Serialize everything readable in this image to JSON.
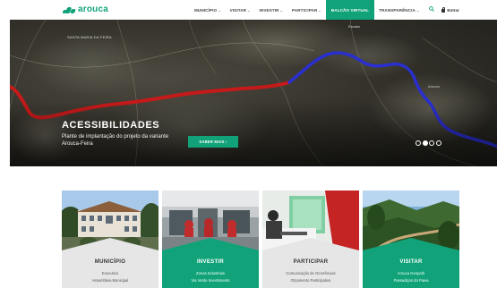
{
  "brand": {
    "name": "arouca",
    "color": "#11a27a"
  },
  "nav": {
    "items": [
      {
        "label": "MUNICÍPIO",
        "has_dropdown": true,
        "active": false
      },
      {
        "label": "VISITAR",
        "has_dropdown": true,
        "active": false
      },
      {
        "label": "INVESTIR",
        "has_dropdown": true,
        "active": false
      },
      {
        "label": "PARTICIPAR",
        "has_dropdown": true,
        "active": false
      },
      {
        "label": "BALCÃO VIRTUAL",
        "has_dropdown": false,
        "active": true
      },
      {
        "label": "TRANSPARÊNCIA",
        "has_dropdown": true,
        "active": false
      }
    ],
    "search_icon": "search-icon",
    "login_label": "Entrar",
    "login_icon": "lock-icon"
  },
  "hero": {
    "map_labels": {
      "location": "SANTA MARIA DA FEIRA",
      "upper": "Escariz",
      "right": "Arouca"
    },
    "title": "ACESSIBILIDADES",
    "subtitle": "Plante de implantação do projeto da variante Arouca-Feira",
    "button_label": "SABER MAIS",
    "button_icon": "chevron-right-icon",
    "slides": 4,
    "active_slide": 2,
    "route_colors": {
      "existing": "#c61a1a",
      "planned": "#2a2fd0"
    }
  },
  "cards": [
    {
      "title": "MUNICÍPIO",
      "lines": [
        "Executivo",
        "Assembleia Municipal"
      ],
      "style": "grey"
    },
    {
      "title": "INVESTIR",
      "lines": [
        "Zonas Industriais",
        "Via Verde Investimento"
      ],
      "style": "green"
    },
    {
      "title": "PARTICIPAR",
      "lines": [
        "Comunicação de Ocorrências",
        "Orçamento Participativo"
      ],
      "style": "grey"
    },
    {
      "title": "VISITAR",
      "lines": [
        "Arouca Geopark",
        "Passadiços do Paiva"
      ],
      "style": "green"
    }
  ]
}
